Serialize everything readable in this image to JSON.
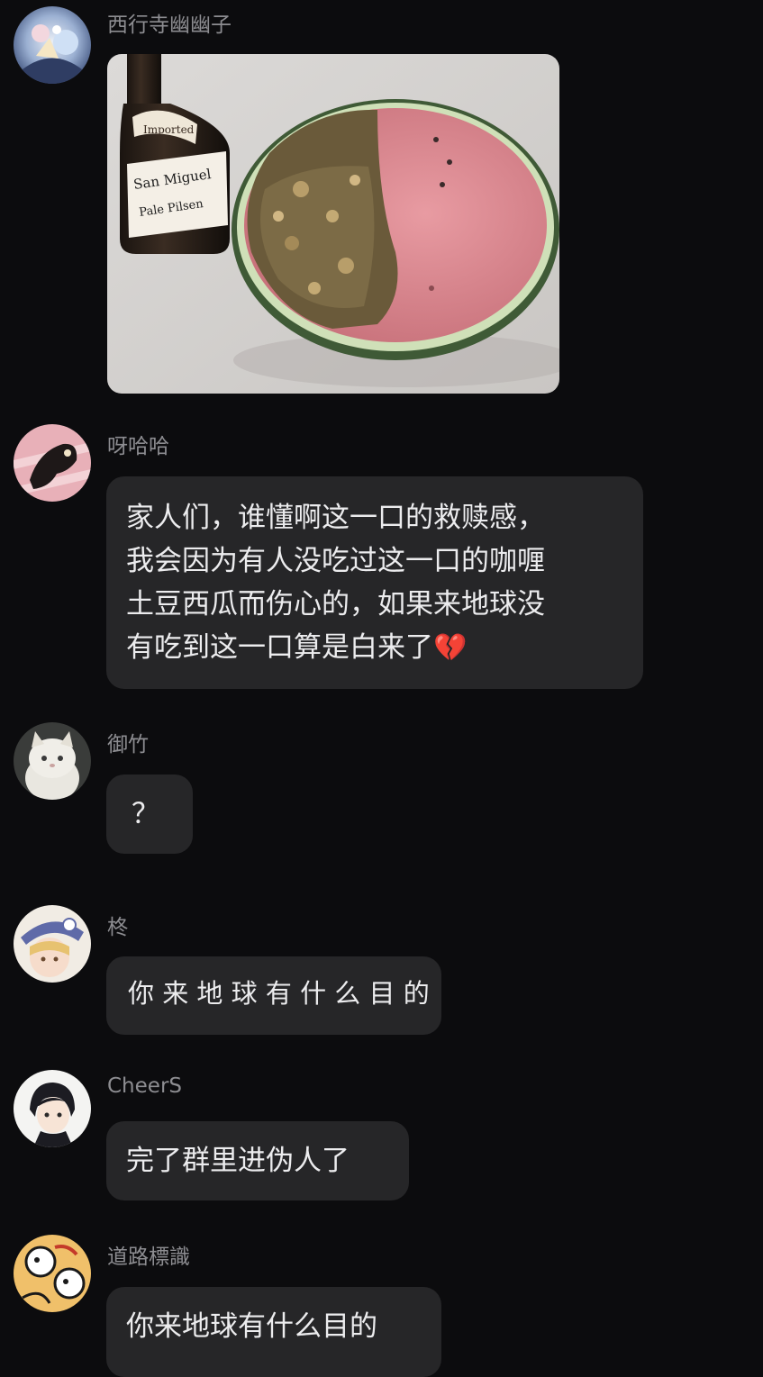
{
  "messages": [
    {
      "sender": "西行寺幽幽子",
      "type": "image",
      "image": {
        "description_icon": "photo-icon",
        "bottle_label_top": "Imported",
        "bottle_label_main": "San Miguel",
        "bottle_label_sub": "Pale Pilsen"
      }
    },
    {
      "sender": "呀哈哈",
      "type": "text",
      "lines": [
        "家人们，谁懂啊这一口的救赎感，",
        "我会因为有人没吃过这一口的咖喱",
        "土豆西瓜而伤心的，如果来地球没",
        "有吃到这一口算是白来了"
      ],
      "emoji": "💔"
    },
    {
      "sender": "御竹",
      "type": "text",
      "text": "？"
    },
    {
      "sender": "柊",
      "type": "text",
      "text": "你 来 地 球 有 什 么 目 的"
    },
    {
      "sender": "CheerS",
      "type": "text",
      "text": "完了群里进伪人了"
    },
    {
      "sender": "道路標識",
      "type": "text",
      "text": "你来地球有什么目的"
    }
  ],
  "colors": {
    "background": "#0c0c0e",
    "bubble": "#262628",
    "sender_name": "#8d8d91",
    "text": "#ececee"
  }
}
